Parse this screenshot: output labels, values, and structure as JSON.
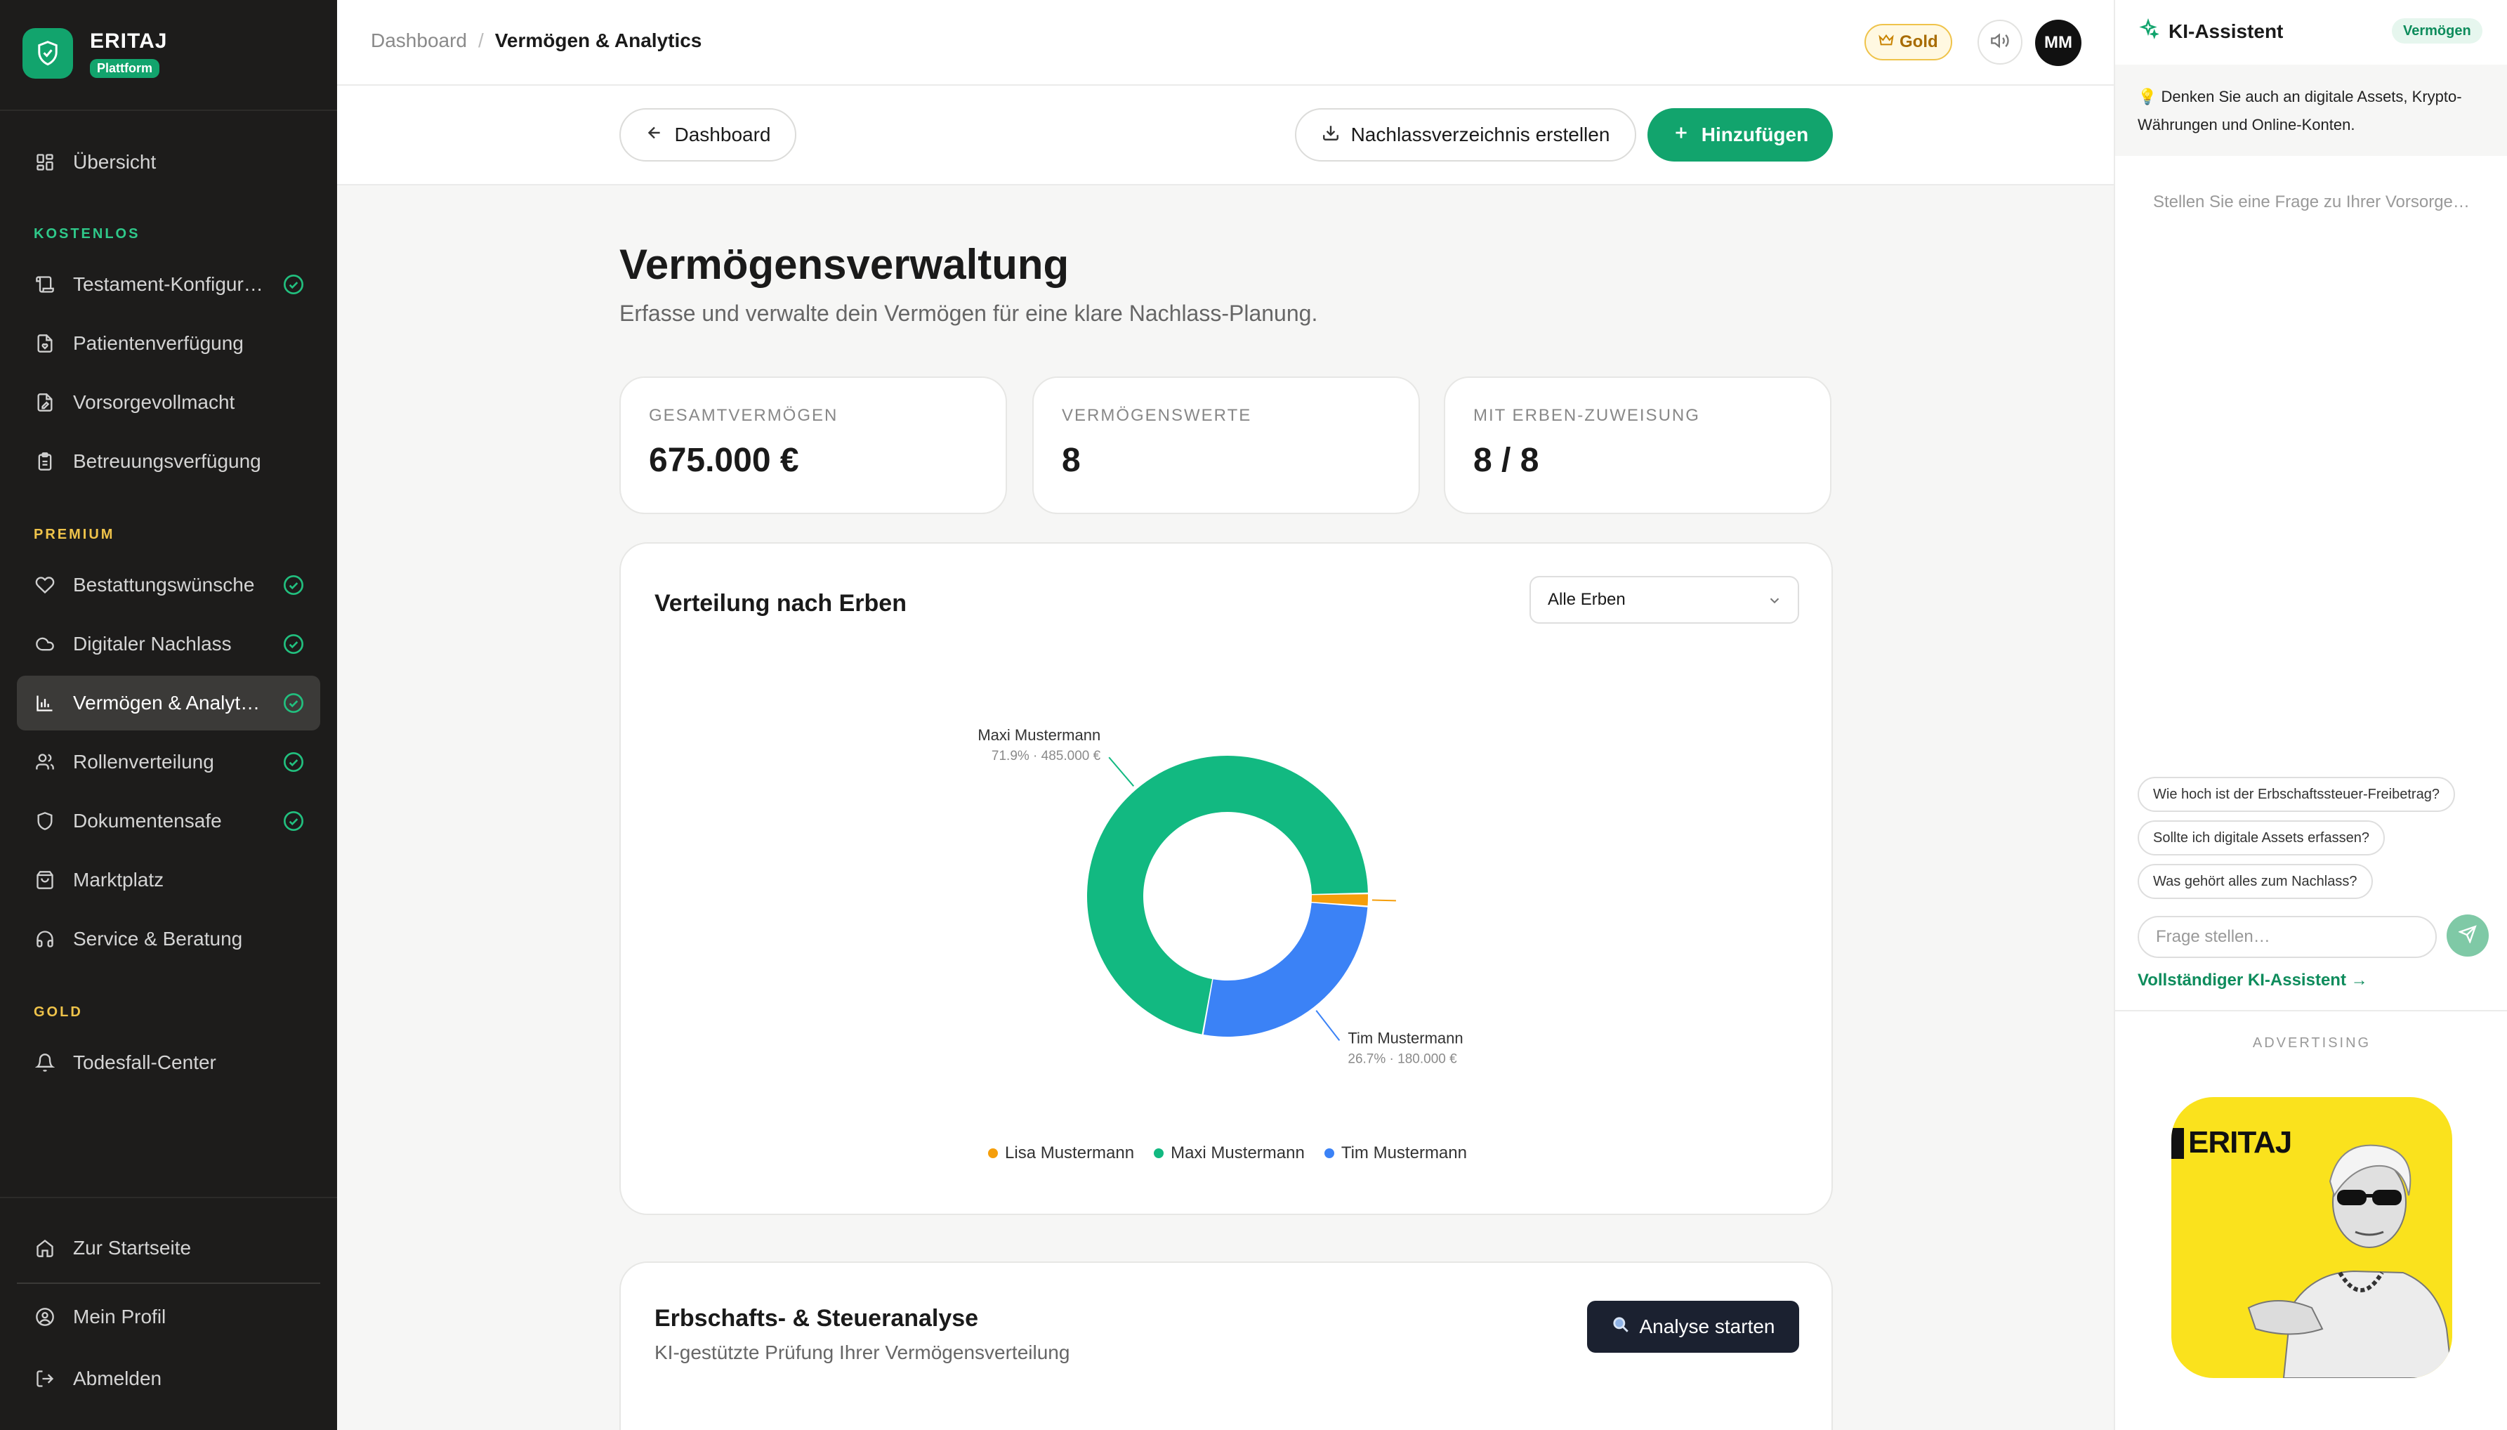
{
  "brand": {
    "name": "ERITAJ",
    "badge": "Plattform"
  },
  "sidebar": {
    "overview": "Übersicht",
    "sections": {
      "free": "KOSTENLOS",
      "premium": "PREMIUM",
      "gold": "GOLD"
    },
    "items": [
      {
        "label": "Testament-Konfigur…"
      },
      {
        "label": "Patientenverfügung"
      },
      {
        "label": "Vorsorgevollmacht"
      },
      {
        "label": "Betreuungsverfügung"
      },
      {
        "label": "Bestattungswünsche"
      },
      {
        "label": "Digitaler Nachlass"
      },
      {
        "label": "Vermögen & Analyt…"
      },
      {
        "label": "Rollenverteilung"
      },
      {
        "label": "Dokumentensafe"
      },
      {
        "label": "Marktplatz"
      },
      {
        "label": "Service & Beratung"
      },
      {
        "label": "Todesfall-Center"
      }
    ],
    "bottom": {
      "home": "Zur Startseite",
      "profile": "Mein Profil",
      "logout": "Abmelden"
    }
  },
  "topbar": {
    "crumb_root": "Dashboard",
    "crumb_sep": "/",
    "crumb_current": "Vermögen & Analytics",
    "plan": "Gold",
    "avatar": "MM"
  },
  "actions": {
    "back": "Dashboard",
    "export": "Nachlassverzeichnis erstellen",
    "add": "Hinzufügen"
  },
  "page": {
    "title": "Vermögensverwaltung",
    "subtitle": "Erfasse und verwalte dein Vermögen für eine klare Nachlass-Planung."
  },
  "stats": [
    {
      "label": "GESAMTVERMÖGEN",
      "value": "675.000 €"
    },
    {
      "label": "VERMÖGENSWERTE",
      "value": "8"
    },
    {
      "label": "MIT ERBEN-ZUWEISUNG",
      "value": "8 / 8"
    }
  ],
  "distribution": {
    "title": "Verteilung nach Erben",
    "filter": "Alle Erben"
  },
  "chart_data": {
    "type": "pie",
    "title": "Verteilung nach Erben",
    "donut": true,
    "legend_position": "bottom",
    "series": [
      {
        "name": "Lisa Mustermann",
        "value": 10000,
        "percent_label": "",
        "color": "#f59e0b"
      },
      {
        "name": "Maxi Mustermann",
        "value": 485000,
        "percent_label": "71.9% · 485.000 €",
        "color": "#12b981"
      },
      {
        "name": "Tim Mustermann",
        "value": 180000,
        "percent_label": "26.7% · 180.000 €",
        "color": "#3b82f6"
      }
    ]
  },
  "analysis": {
    "title": "Erbschafts- & Steueranalyse",
    "subtitle": "KI-gestützte Prüfung Ihrer Vermögensverteilung",
    "button": "Analyse starten"
  },
  "assistant": {
    "title": "KI-Assistent",
    "context": "Vermögen",
    "tip": "Denken Sie auch an digitale Assets, Krypto-Währungen und Online-Konten.",
    "empty": "Stellen Sie eine Frage zu Ihrer Vorsorge…",
    "suggestions": [
      "Wie hoch ist der Erbschaftssteuer-Freibetrag?",
      "Sollte ich digitale Assets erfassen?",
      "Was gehört alles zum Nachlass?"
    ],
    "input_placeholder": "Frage stellen…",
    "full_link": "Vollständiger KI-Assistent →",
    "ad_label": "ADVERTISING",
    "ad_brand": "ERITAJ"
  }
}
